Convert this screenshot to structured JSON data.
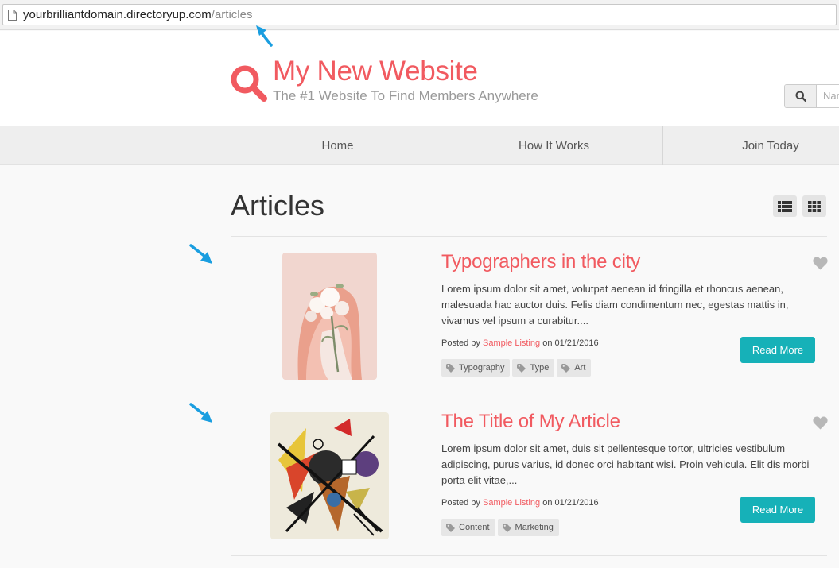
{
  "browser": {
    "url_domain": "yourbrilliantdomain.directoryup.com",
    "url_path": "/articles"
  },
  "header": {
    "site_title": "My New Website",
    "tagline": "The #1 Website To Find Members Anywhere",
    "search_placeholder": "Nar"
  },
  "nav": {
    "items": [
      {
        "label": "Home"
      },
      {
        "label": "How It Works"
      },
      {
        "label": "Join Today"
      }
    ]
  },
  "main": {
    "title": "Articles",
    "articles": [
      {
        "title": "Typographers in the city",
        "excerpt": "Lorem ipsum dolor sit amet, volutpat aenean id fringilla et rhoncus aenean, malesuada hac auctor duis. Felis diam condimentum nec, egestas mattis in, vivamus vel ipsum a curabitur....",
        "posted_by_prefix": "Posted by",
        "author": "Sample Listing",
        "on_prefix": "on",
        "date": "01/21/2016",
        "tags": [
          "Typography",
          "Type",
          "Art"
        ],
        "read_more": "Read More"
      },
      {
        "title": "The Title of My Article",
        "excerpt": "Lorem ipsum dolor sit amet, duis sit pellentesque tortor, ultricies vestibulum adipiscing, purus varius, id donec orci habitant wisi. Proin vehicula. Elit dis morbi porta elit vitae,...",
        "posted_by_prefix": "Posted by",
        "author": "Sample Listing",
        "on_prefix": "on",
        "date": "01/21/2016",
        "tags": [
          "Content",
          "Marketing"
        ],
        "read_more": "Read More"
      }
    ]
  },
  "colors": {
    "brand": "#f15a60",
    "button": "#16b1b8",
    "annotation_arrow": "#1a9ee0"
  }
}
